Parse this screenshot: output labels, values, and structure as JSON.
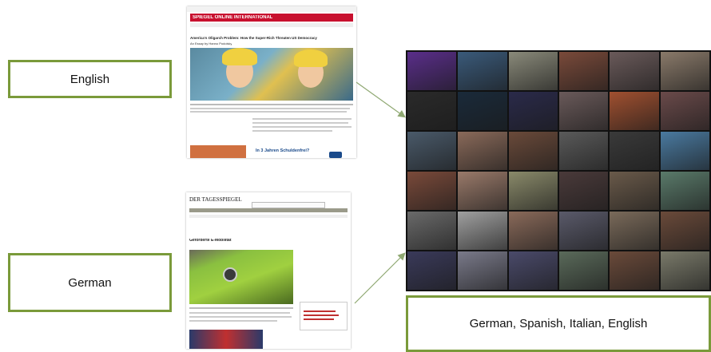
{
  "labels": {
    "english": "English",
    "german": "German",
    "combined": "German, Spanish, Italian, English"
  },
  "english_page": {
    "masthead": "SPIEGEL ONLINE  INTERNATIONAL",
    "headline": "America's Oligarch Problem: How the Super-Rich Threaten US Democracy",
    "byline": "An Essay by Hanno Podolsky",
    "ad_text": "In 3 Jahren Schuldenfrei?"
  },
  "german_page": {
    "masthead": "DER TAGESSPIEGEL",
    "headline": "Geförderte E-Mobilität"
  },
  "colors": {
    "box_border": "#7a9a3a",
    "arrow": "#8fa872",
    "spiegel_red": "#c8102e"
  },
  "tile_colors": [
    "#5a2e8a",
    "#3a5a7a",
    "#8a8a7a",
    "#7a4a3a",
    "#6a5a5a",
    "#8a7a6a",
    "#2a2a2a",
    "#1a2a3a",
    "#2a2a4a",
    "#6a5a5a",
    "#a05030",
    "#6a4a4a",
    "#4a5a6a",
    "#8a6a5a",
    "#6a4a3a",
    "#5a5a5a",
    "#3a3a3a",
    "#4a7aa0",
    "#7a4a3a",
    "#9a7a6a",
    "#8a8a6a",
    "#4a3a3a",
    "#6a5a4a",
    "#5a7a6a",
    "#6a6a6a",
    "#a0a0a0",
    "#8a6a5a",
    "#5a5a6a",
    "#7a6a5a",
    "#6a4a3a",
    "#3a3a5a",
    "#7a7a8a",
    "#4a4a6a",
    "#5a6a5a",
    "#6a4a3a",
    "#7a7a6a"
  ]
}
